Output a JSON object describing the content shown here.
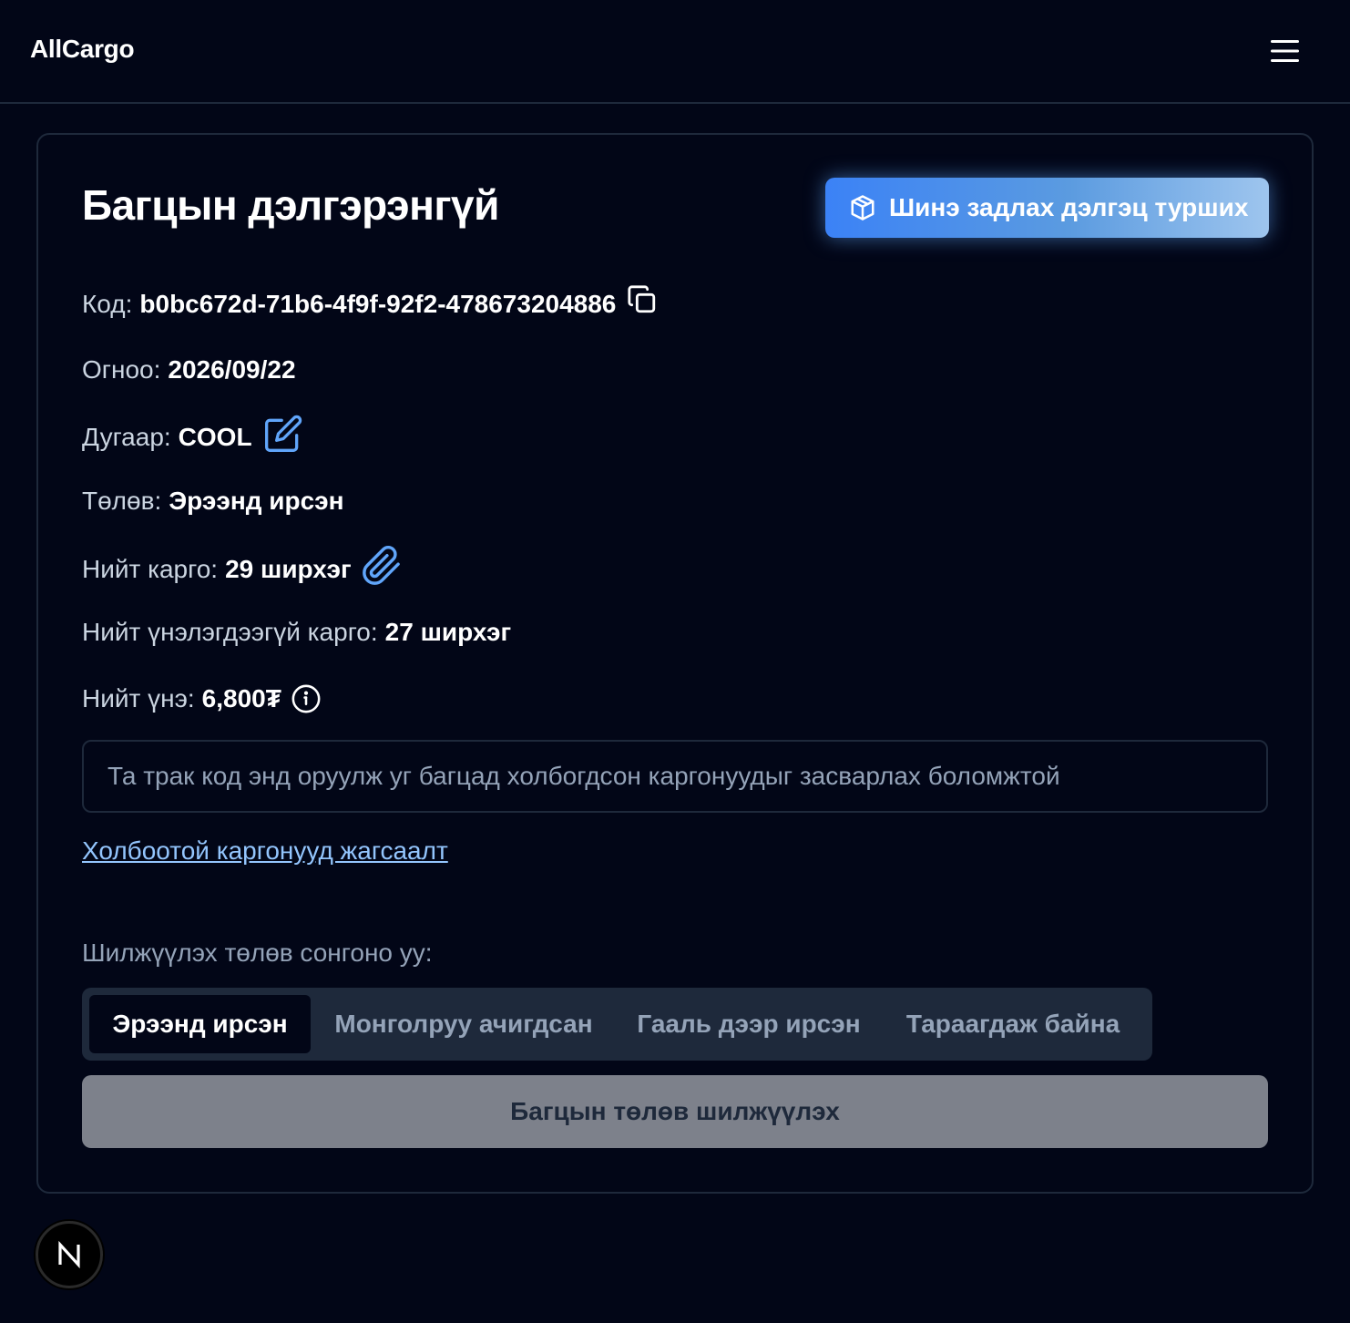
{
  "header": {
    "logo": "AllCargo",
    "menu_icon": "hamburger-menu-icon"
  },
  "card": {
    "title": "Багцын дэлгэрэнгүй",
    "cta_label": "Шинэ задлах дэлгэц турших",
    "cta_icon": "package-box-icon",
    "fields": {
      "code": {
        "label": "Код:",
        "value": "b0bc672d-71b6-4f9f-92f2-478673204886",
        "icon": "copy-icon"
      },
      "date": {
        "label": "Огноо:",
        "value": "2026/09/22"
      },
      "number": {
        "label": "Дугаар:",
        "value": "COOL",
        "icon": "edit-icon"
      },
      "status": {
        "label": "Төлөв:",
        "value": "Эрээнд ирсэн"
      },
      "total_cargo": {
        "label": "Нийт карго:",
        "value": "29 ширхэг",
        "icon": "paperclip-icon"
      },
      "unpriced_cargo": {
        "label": "Нийт үнэлэгдээгүй карго:",
        "value": "27 ширхэг"
      },
      "total_price": {
        "label": "Нийт үнэ:",
        "value": "6,800₮",
        "icon": "info-icon"
      }
    },
    "track_input": {
      "placeholder": "Та трак код энд оруулж уг багцад холбогдсон каргонуудыг засварлах боломжтой",
      "value": ""
    },
    "linked_list_link": "Холбоотой каргонууд жагсаалт",
    "status_select_label": "Шилжүүлэх төлөв сонгоно уу:",
    "status_tabs": [
      {
        "label": "Эрээнд ирсэн",
        "active": true
      },
      {
        "label": "Монголруу ачигдсан",
        "active": false
      },
      {
        "label": "Гааль дээр ирсэн",
        "active": false
      },
      {
        "label": "Тараагдаж байна",
        "active": false
      }
    ],
    "submit_label": "Багцын төлөв шилжүүлэх"
  },
  "badge": {
    "letter": "N"
  },
  "colors": {
    "background": "#020617",
    "border": "#1e293b",
    "accent": "#3b82f6",
    "link": "#93c5fd",
    "muted_text": "#94a3b8"
  }
}
